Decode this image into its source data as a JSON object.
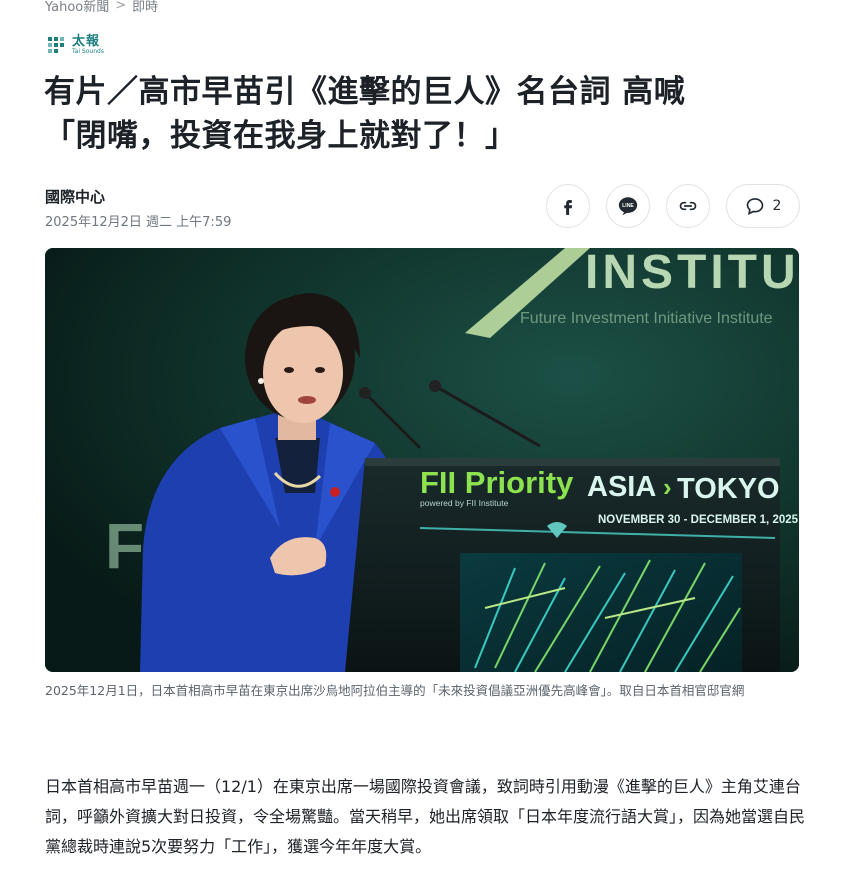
{
  "breadcrumb": {
    "site": "Yahoo新聞",
    "separator": ">",
    "section": "即時"
  },
  "source": {
    "name_cn": "太報",
    "name_en": "Tai Sounds",
    "icon": "taibao-logo-icon",
    "brand_color": "#1f7f7f"
  },
  "article": {
    "headline_line1": "有片／高市早苗引《進擊的巨人》名台詞 高喊",
    "headline_line2": "「閉嘴，投資在我身上就對了！」",
    "author": "國際中心",
    "timestamp": "2025年12月2日 週二 上午7:59"
  },
  "share": {
    "facebook_icon": "facebook-icon",
    "line_icon": "line-icon",
    "line_label": "LINE",
    "link_icon": "link-icon",
    "comment_icon": "comment-icon",
    "comment_count": "2"
  },
  "hero_image": {
    "backdrop_text": "INSTITUTE",
    "backdrop_subtext": "Future Investment Initiative Institute",
    "backdrop_letters": "FI",
    "podium_title_green": "FII Priority",
    "podium_title_white": "ASIA",
    "podium_arrow": "›",
    "podium_title_city": "TOKYO",
    "podium_powered": "powered by FII Institute",
    "podium_dates": "NOVEMBER 30 - DECEMBER 1, 2025",
    "accent_green": "#7ed957"
  },
  "caption": "2025年12月1日，日本首相高市早苗在東京出席沙烏地阿拉伯主導的「未來投資倡議亞洲優先高峰會」。取自日本首相官邸官網",
  "body": {
    "paragraph": "日本首相高市早苗週一（12/1）在東京出席一場國際投資會議，致詞時引用動漫《進擊的巨人》主角艾連台詞，呼籲外資擴大對日投資，令全場驚豔。當天稍早，她出席領取「日本年度流行語大賞」，因為她當選自民黨總裁時連說5次要努力「工作」，獲選今年年度大賞。"
  }
}
